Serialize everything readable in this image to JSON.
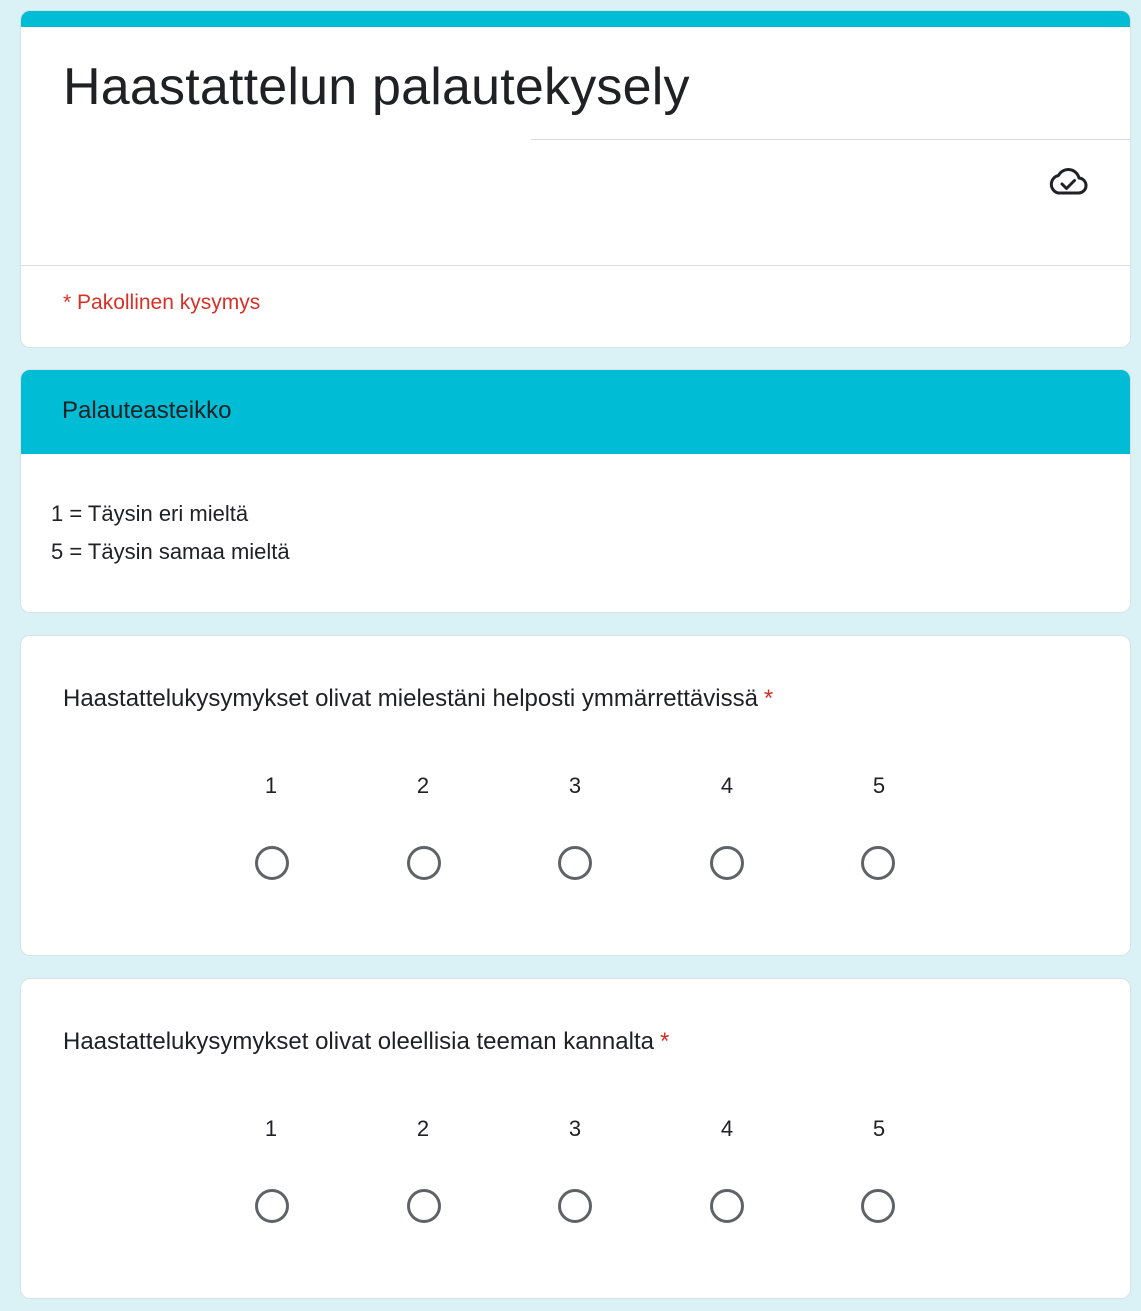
{
  "form": {
    "title": "Haastattelun palautekysely",
    "required_note": "* Pakollinen kysymys",
    "cloud_icon": "cloud-check-icon",
    "accent_color": "#00bcd4",
    "required_color": "#d93025"
  },
  "section": {
    "title": "Palauteasteikko",
    "description": [
      "1 = Täysin eri mieltä",
      "5 = Täysin samaa mieltä"
    ]
  },
  "questions": [
    {
      "text": "Haastattelukysymykset olivat mielestäni helposti ymmärrettävissä",
      "required_mark": "*",
      "scale": [
        "1",
        "2",
        "3",
        "4",
        "5"
      ]
    },
    {
      "text": "Haastattelukysymykset olivat oleellisia teeman kannalta",
      "required_mark": "*",
      "scale": [
        "1",
        "2",
        "3",
        "4",
        "5"
      ]
    }
  ]
}
